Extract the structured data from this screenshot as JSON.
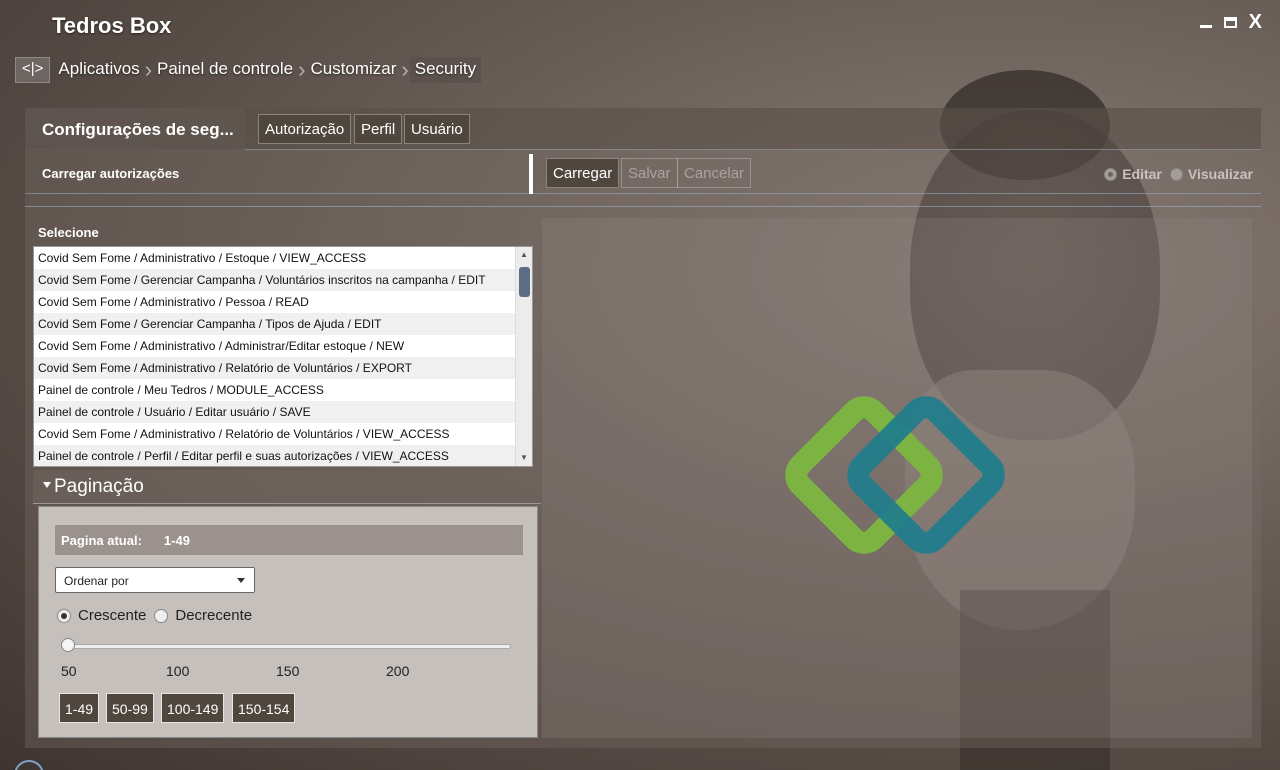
{
  "app": {
    "title": "Tedros Box"
  },
  "window": {
    "minimize": "minimize",
    "maximize": "maximize",
    "close_label": "X"
  },
  "breadcrumb": {
    "back_label": "<|>",
    "items": [
      "Aplicativos",
      "Painel de controle",
      "Customizar",
      "Security"
    ]
  },
  "tabs": {
    "title": "Configurações de seg...",
    "items": [
      "Autorização",
      "Perfil",
      "Usuário"
    ]
  },
  "actions": {
    "label": "Carregar autorizações",
    "load": "Carregar",
    "save": "Salvar",
    "cancel": "Cancelar",
    "modes": [
      "Editar",
      "Visualizar"
    ]
  },
  "selection": {
    "label": "Selecione",
    "items": [
      "Covid Sem Fome / Administrativo / Estoque / VIEW_ACCESS",
      "Covid Sem Fome / Gerenciar Campanha / Voluntários inscritos na campanha / EDIT",
      "Covid Sem Fome / Administrativo / Pessoa / READ",
      "Covid Sem Fome / Gerenciar Campanha / Tipos de Ajuda / EDIT",
      "Covid Sem Fome / Administrativo / Administrar/Editar estoque / NEW",
      "Covid Sem Fome / Administrativo / Relatório de Voluntários / EXPORT",
      "Painel de controle / Meu Tedros / MODULE_ACCESS",
      "Painel de controle / Usuário / Editar usuário / SAVE",
      "Covid Sem Fome / Administrativo / Relatório de Voluntários / VIEW_ACCESS",
      "Painel de controle / Perfil / Editar perfil e suas autorizações / VIEW_ACCESS"
    ]
  },
  "pagination": {
    "title": "Paginação",
    "current_label": "Pagina atual:",
    "current_value": "1-49",
    "sort_placeholder": "Ordenar por",
    "ascending": "Crescente",
    "descending": "Decrecente",
    "slider_ticks": [
      "50",
      "100",
      "150",
      "200"
    ],
    "slider_value": 50,
    "pages": [
      "1-49",
      "50-99",
      "100-149",
      "150-154"
    ]
  },
  "colors": {
    "accent_green": "#7cb342",
    "accent_teal": "#1e7d8c"
  }
}
